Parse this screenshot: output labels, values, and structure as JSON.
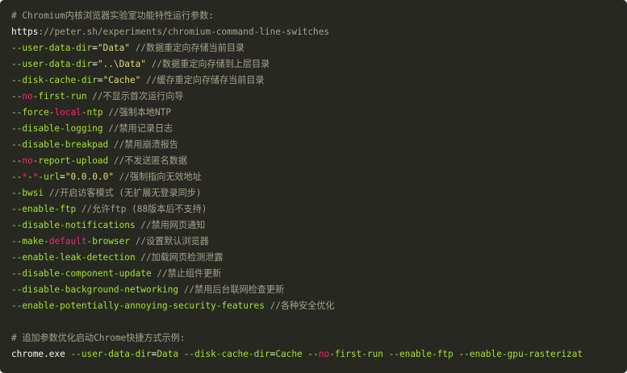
{
  "colors": {
    "background": "#272822",
    "comment": "#a6a28c",
    "plain": "#f8f8f2",
    "option": "#a6e22e",
    "string": "#e6db74",
    "keyword": "#f92672"
  },
  "lines": [
    [
      {
        "t": "# Chromium内核浏览器实验室功能特性运行参数:",
        "c": "comment"
      }
    ],
    [
      {
        "t": "https",
        "c": "plain"
      },
      {
        "t": "://peter.sh/experiments/chromium-command-line-switches",
        "c": "comment"
      }
    ],
    [
      {
        "t": "--user-data-dir",
        "c": "option"
      },
      {
        "t": "=",
        "c": "op"
      },
      {
        "t": "\"Data\"",
        "c": "str"
      },
      {
        "t": " //数据重定向存储当前目录",
        "c": "comment"
      }
    ],
    [
      {
        "t": "--user-data-dir",
        "c": "option"
      },
      {
        "t": "=",
        "c": "op"
      },
      {
        "t": "\"..\\Data\"",
        "c": "str"
      },
      {
        "t": " //数据重定向存储到上层目录",
        "c": "comment"
      }
    ],
    [
      {
        "t": "--disk-cache-dir",
        "c": "option"
      },
      {
        "t": "=",
        "c": "op"
      },
      {
        "t": "\"Cache\"",
        "c": "str"
      },
      {
        "t": " //缓存重定向存储存当前目录",
        "c": "comment"
      }
    ],
    [
      {
        "t": "--",
        "c": "option"
      },
      {
        "t": "no",
        "c": "kw"
      },
      {
        "t": "-first-run",
        "c": "option"
      },
      {
        "t": " //不显示首次运行向导",
        "c": "comment"
      }
    ],
    [
      {
        "t": "--force-",
        "c": "option"
      },
      {
        "t": "local",
        "c": "kw"
      },
      {
        "t": "-ntp",
        "c": "option"
      },
      {
        "t": " //强制本地NTP",
        "c": "comment"
      }
    ],
    [
      {
        "t": "--disable-logging",
        "c": "option"
      },
      {
        "t": " //禁用记录日志",
        "c": "comment"
      }
    ],
    [
      {
        "t": "--disable-breakpad",
        "c": "option"
      },
      {
        "t": " //禁用崩溃报告",
        "c": "comment"
      }
    ],
    [
      {
        "t": "--",
        "c": "option"
      },
      {
        "t": "no",
        "c": "kw"
      },
      {
        "t": "-report-upload",
        "c": "option"
      },
      {
        "t": " //不发送匿名数据",
        "c": "comment"
      }
    ],
    [
      {
        "t": "--",
        "c": "option"
      },
      {
        "t": "*",
        "c": "kw"
      },
      {
        "t": "-",
        "c": "option"
      },
      {
        "t": "*",
        "c": "kw"
      },
      {
        "t": "-url",
        "c": "option"
      },
      {
        "t": "=",
        "c": "op"
      },
      {
        "t": "\"0.0.0.0\"",
        "c": "str"
      },
      {
        "t": " //强制指向无效地址",
        "c": "comment"
      }
    ],
    [
      {
        "t": "--bwsi",
        "c": "option"
      },
      {
        "t": " //开启访客模式 (无扩展无登录同步)",
        "c": "comment"
      }
    ],
    [
      {
        "t": "--enable-ftp",
        "c": "option"
      },
      {
        "t": " //允许ftp (88版本后不支持)",
        "c": "comment"
      }
    ],
    [
      {
        "t": "--disable-notifications",
        "c": "option"
      },
      {
        "t": " //禁用网页通知",
        "c": "comment"
      }
    ],
    [
      {
        "t": "--make-",
        "c": "option"
      },
      {
        "t": "default",
        "c": "kw"
      },
      {
        "t": "-browser",
        "c": "option"
      },
      {
        "t": " //设置默认浏览器",
        "c": "comment"
      }
    ],
    [
      {
        "t": "--enable-leak-detection",
        "c": "option"
      },
      {
        "t": " //加载网页检测泄露",
        "c": "comment"
      }
    ],
    [
      {
        "t": "--disable-component-update",
        "c": "option"
      },
      {
        "t": " //禁止组件更新",
        "c": "comment"
      }
    ],
    [
      {
        "t": "--disable-background-networking",
        "c": "option"
      },
      {
        "t": " //禁用后台联网检查更新",
        "c": "comment"
      }
    ],
    [
      {
        "t": "--enable-potentially-annoying-security-features",
        "c": "option"
      },
      {
        "t": " //各种安全优化",
        "c": "comment"
      }
    ],
    [],
    [
      {
        "t": "# 追加参数优化启动Chrome快捷方式示例:",
        "c": "comment"
      }
    ],
    [
      {
        "t": "chrome.exe ",
        "c": "plain"
      },
      {
        "t": "--user-data-dir",
        "c": "option"
      },
      {
        "t": "=",
        "c": "op"
      },
      {
        "t": "Data",
        "c": "option"
      },
      {
        "t": " ",
        "c": "plain"
      },
      {
        "t": "--disk-cache-dir",
        "c": "option"
      },
      {
        "t": "=",
        "c": "op"
      },
      {
        "t": "Cache",
        "c": "option"
      },
      {
        "t": " ",
        "c": "plain"
      },
      {
        "t": "--",
        "c": "option"
      },
      {
        "t": "no",
        "c": "kw"
      },
      {
        "t": "-first-run",
        "c": "option"
      },
      {
        "t": " ",
        "c": "plain"
      },
      {
        "t": "--enable-ftp",
        "c": "option"
      },
      {
        "t": " ",
        "c": "plain"
      },
      {
        "t": "--enable-gpu-rasterizat",
        "c": "option"
      }
    ]
  ]
}
